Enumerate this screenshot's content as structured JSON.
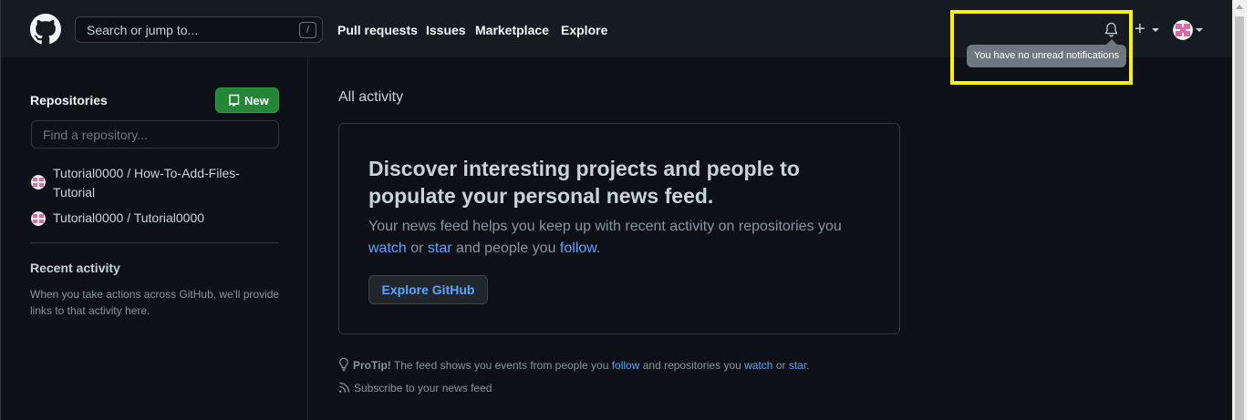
{
  "header": {
    "logo_icon": "github-octocat-icon",
    "search_placeholder": "Search or jump to...",
    "search_shortcut": "/",
    "nav": [
      "Pull requests",
      "Issues",
      "Marketplace",
      "Explore"
    ],
    "notifications_icon": "bell-icon",
    "notifications_tooltip": "You have no unread notifications",
    "create_label": "+",
    "highlight_color": "#fff200"
  },
  "sidebar": {
    "repositories_title": "Repositories",
    "new_button": "New",
    "find_placeholder": "Find a repository...",
    "repos": [
      {
        "line1": "Tutorial0000 / How-To-Add-Files-",
        "line2": "Tutorial"
      },
      {
        "line1": "Tutorial0000 / Tutorial0000",
        "line2": ""
      }
    ],
    "recent_title": "Recent activity",
    "recent_text": "When you take actions across GitHub, we'll provide links to that activity here."
  },
  "main": {
    "heading": "All activity",
    "card": {
      "title": "Discover interesting projects and people to populate your personal news feed.",
      "desc_1": "Your news feed helps you keep up with recent activity on repositories you ",
      "watch": "watch",
      "or": " or ",
      "star": "star",
      "desc_2": " and people you ",
      "follow": "follow",
      "period": ".",
      "button": "Explore GitHub"
    },
    "protip": {
      "label": "ProTip!",
      "text_1": " The feed shows you events from people you ",
      "follow": "follow",
      "text_2": " and repositories you ",
      "watch": "watch",
      "or": " or ",
      "star": "star",
      "period": "."
    },
    "subscribe": "Subscribe to your news feed"
  },
  "colors": {
    "background": "#0d1117",
    "header": "#161b22",
    "accent_blue": "#58a6ff",
    "new_button_green": "#238636"
  }
}
